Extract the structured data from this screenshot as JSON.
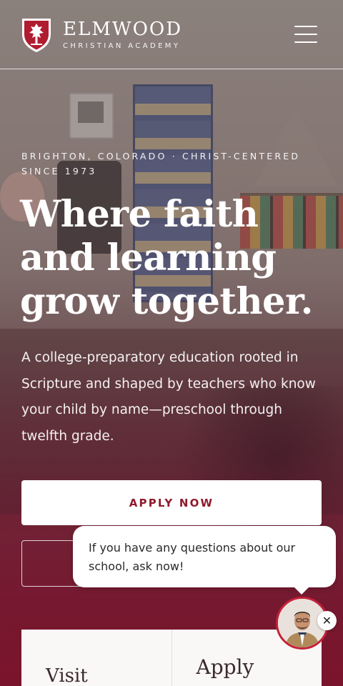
{
  "header": {
    "brand_name": "ELMWOOD",
    "brand_sub": "CHRISTIAN ACADEMY",
    "menu_icon": "hamburger-menu-icon",
    "crest_icon": "shield-crest-icon"
  },
  "hero": {
    "eyebrow": "BRIGHTON, COLORADO · CHRIST-CENTERED SINCE 1973",
    "headline": "Where faith and learning grow together.",
    "lede": "A college-preparatory education rooted in Scripture and shaped by teachers who know your child by name—preschool through twelfth grade."
  },
  "actions": {
    "apply_label": "APPLY NOW",
    "secondary_label": ""
  },
  "cards": [
    {
      "title": "Visit"
    },
    {
      "title": "Apply"
    }
  ],
  "chat": {
    "message": "If you have any questions about our school, ask now!",
    "close_icon": "close-icon",
    "avatar_icon": "agent-avatar-icon"
  },
  "colors": {
    "brand": "#8e1b2e",
    "accent_red": "#c4213a",
    "card_bg": "#faf8f6"
  }
}
